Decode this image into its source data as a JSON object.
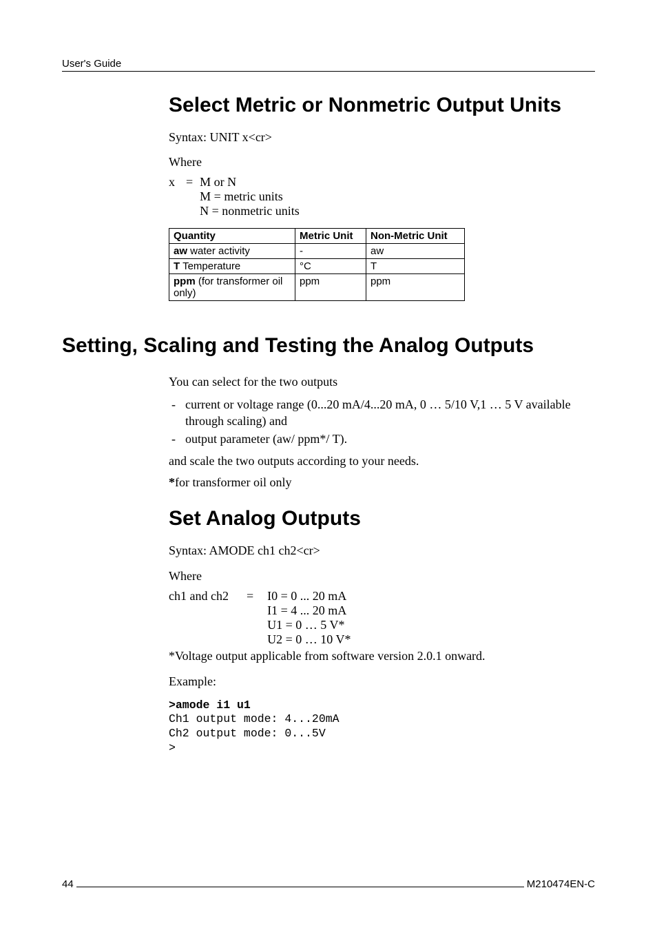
{
  "header": {
    "label": "User's Guide"
  },
  "section1": {
    "title": "Select Metric or Nonmetric Output Units",
    "syntax": "Syntax: UNIT x<cr>",
    "where": "Where",
    "def_var": "x",
    "def_eq": "=",
    "def_val_l1": "M or N",
    "def_val_l2": "M = metric units",
    "def_val_l3": "N = nonmetric units",
    "table": {
      "headers": {
        "q": "Quantity",
        "m": "Metric Unit",
        "n": "Non-Metric Unit"
      },
      "rows": [
        {
          "q_bold": "aw",
          "q_rest": " water activity",
          "m": "-",
          "n": "aw"
        },
        {
          "q_bold": "T",
          "q_rest": " Temperature",
          "m": "°C",
          "n": "T"
        },
        {
          "q_bold": "ppm",
          "q_rest": " (for transformer oil only)",
          "m": "ppm",
          "n": "ppm"
        }
      ]
    }
  },
  "section2": {
    "title": "Setting, Scaling and Testing the Analog Outputs",
    "intro": "You can select for the two outputs",
    "bullets": [
      "current or voltage range (0...20 mA/4...20 mA, 0 … 5/10 V,1 … 5 V available through scaling) and",
      "output parameter (aw/ ppm*/ T)."
    ],
    "line1": "and scale the two outputs according to your needs.",
    "line2_bold": "*",
    "line2_rest": "for transformer oil only"
  },
  "section3": {
    "title": "Set Analog Outputs",
    "syntax": "Syntax: AMODE ch1 ch2<cr>",
    "where": "Where",
    "def_var": "ch1 and ch2",
    "def_eq": "=",
    "def_l1": "I0 = 0 ... 20 mA",
    "def_l2": "I1 = 4 ... 20 mA",
    "def_l3": "U1 = 0 … 5 V*",
    "def_l4": "U2 = 0 … 10 V*",
    "note": "*Voltage output applicable from software version 2.0.1 onward.",
    "example_label": "Example:",
    "code_l1": ">amode i1 u1",
    "code_l2": "Ch1 output mode: 4...20mA",
    "code_l3": "Ch2 output mode: 0...5V",
    "code_l4": ">"
  },
  "footer": {
    "page": "44",
    "docid": "M210474EN-C"
  }
}
